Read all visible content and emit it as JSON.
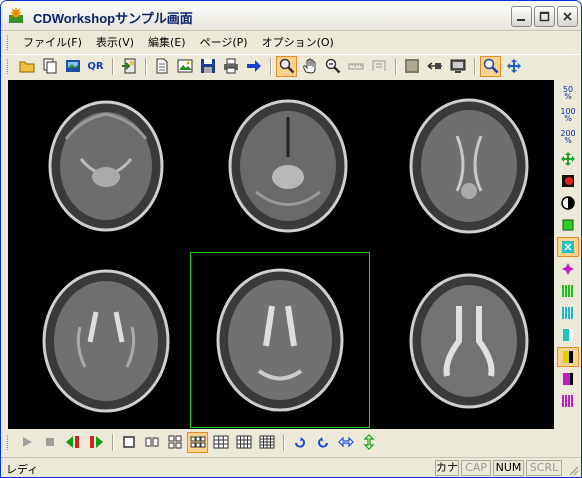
{
  "window": {
    "title": "CDWorkshopサンプル画面"
  },
  "menubar": {
    "items": [
      "ファイル(F)",
      "表示(V)",
      "編集(E)",
      "ページ(P)",
      "オプション(O)"
    ]
  },
  "toolbar": {
    "buttons": [
      "open-folder",
      "copy",
      "save-as-image",
      "qr-code",
      "import",
      "new-page",
      "image",
      "save",
      "print",
      "next-arrow",
      "zoom-select",
      "pan-hand",
      "zoom-out",
      "measure-ruler",
      "multi-select",
      "window-level",
      "back-arrow",
      "monitor",
      "magnifier",
      "move-cross"
    ],
    "qr_label": "QR"
  },
  "right_toolbar": {
    "zoom_labels": [
      "50",
      "100",
      "200"
    ],
    "zoom_unit": "%"
  },
  "bottom_toolbar": {
    "layouts": [
      "1x1",
      "1x2",
      "2x2",
      "2x3",
      "3x3",
      "3x4",
      "4x4"
    ],
    "selected_layout": "2x3"
  },
  "viewer": {
    "images": 6,
    "selected_index": 4
  },
  "statusbar": {
    "text": "レディ",
    "kana": "カナ",
    "cap": "CAP",
    "num": "NUM",
    "scrl": "SCRL"
  }
}
